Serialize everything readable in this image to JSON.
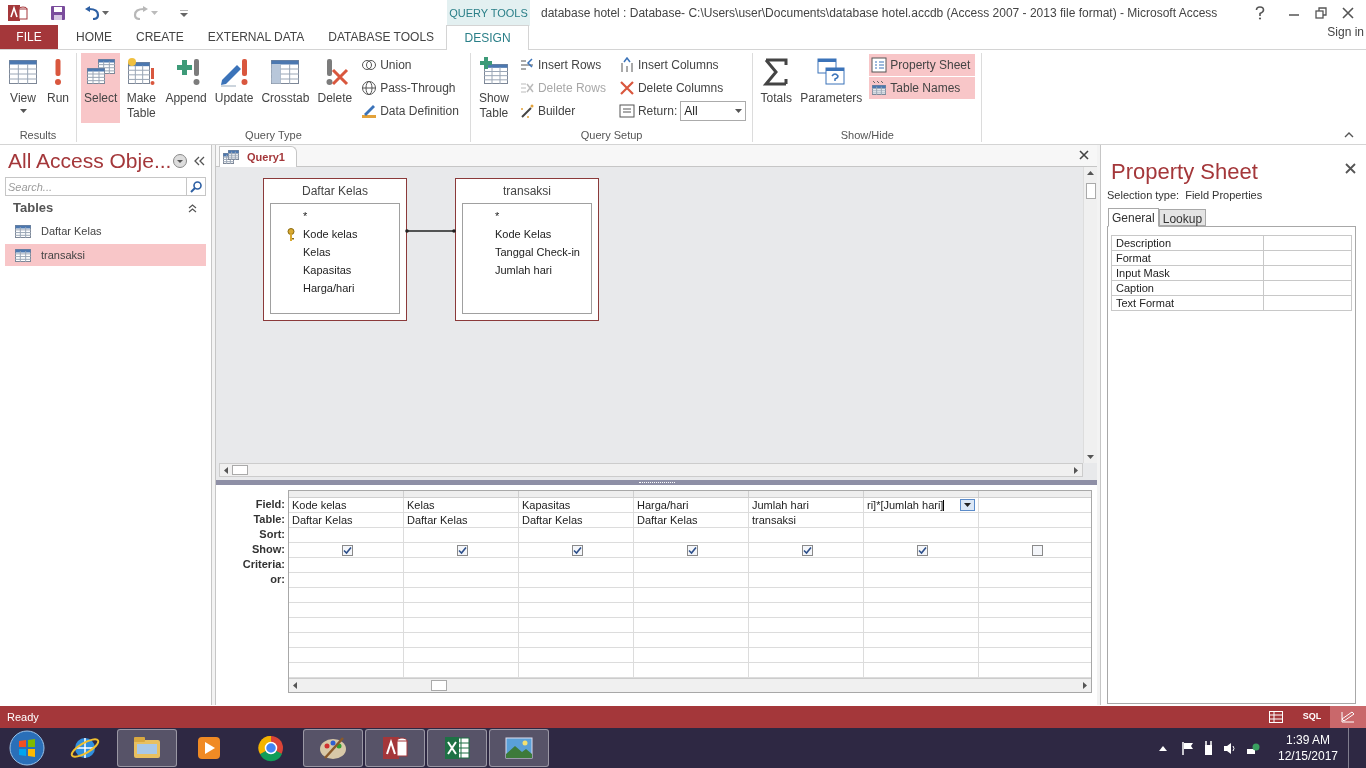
{
  "window": {
    "title": "database hotel : Database- C:\\Users\\user\\Documents\\database hotel.accdb (Access 2007 - 2013 file format) - Microsoft Access",
    "context_tab": "QUERY TOOLS"
  },
  "tabs": [
    {
      "label": "FILE",
      "kind": "file",
      "selected": false
    },
    {
      "label": "HOME",
      "kind": "tab",
      "selected": false
    },
    {
      "label": "CREATE",
      "kind": "tab",
      "selected": false
    },
    {
      "label": "EXTERNAL DATA",
      "kind": "tab",
      "selected": false
    },
    {
      "label": "DATABASE TOOLS",
      "kind": "tab",
      "selected": false
    },
    {
      "label": "DESIGN",
      "kind": "context",
      "selected": true
    }
  ],
  "sign_in": "Sign in",
  "ribbon": [
    {
      "label": "Results",
      "buttons": [
        {
          "kind": "large",
          "label": "View",
          "dropdown": true
        },
        {
          "kind": "large",
          "label": "Run",
          "dropdown": false
        }
      ]
    },
    {
      "label": "Query Type",
      "buttons": [
        {
          "kind": "large",
          "label": "Select",
          "selected": true
        },
        {
          "kind": "large",
          "label": "Make Table",
          "selected": false
        },
        {
          "kind": "large",
          "label": "Append",
          "selected": false
        },
        {
          "kind": "large",
          "label": "Update",
          "selected": false
        },
        {
          "kind": "large",
          "label": "Crosstab",
          "selected": false
        },
        {
          "kind": "large",
          "label": "Delete",
          "selected": false
        },
        {
          "kind": "small",
          "label": "Union",
          "selected": false
        },
        {
          "kind": "small",
          "label": "Pass-Through",
          "selected": false
        },
        {
          "kind": "small",
          "label": "Data Definition",
          "selected": false
        }
      ]
    },
    {
      "label": "Query Setup",
      "buttons": [
        {
          "kind": "large",
          "label": "Show Table",
          "disabled": false
        },
        {
          "kind": "small",
          "label": "Insert Rows",
          "disabled": false
        },
        {
          "kind": "small",
          "label": "Delete Rows",
          "disabled": true
        },
        {
          "kind": "small",
          "label": "Builder",
          "disabled": false
        },
        {
          "kind": "small",
          "label": "Insert Columns",
          "disabled": false
        },
        {
          "kind": "small",
          "label": "Delete Columns",
          "disabled": false
        },
        {
          "kind": "combo",
          "label": "Return:",
          "value": "All",
          "disabled": false
        }
      ]
    },
    {
      "label": "Show/Hide",
      "buttons": [
        {
          "kind": "large",
          "label": "Totals",
          "on": false
        },
        {
          "kind": "large",
          "label": "Parameters",
          "on": false
        },
        {
          "kind": "small",
          "label": "Property Sheet",
          "on": true
        },
        {
          "kind": "small",
          "label": "Table Names",
          "on": true
        }
      ]
    }
  ],
  "nav_pane": {
    "title": "All Access Obje...",
    "search_placeholder": "Search...",
    "group": "Tables",
    "items": [
      {
        "label": "Daftar Kelas",
        "selected": false
      },
      {
        "label": "transaksi",
        "selected": true
      }
    ]
  },
  "document_tab": {
    "label": "Query1"
  },
  "design_tables": [
    {
      "name": "Daftar Kelas",
      "fields": [
        {
          "name": "*",
          "key": false
        },
        {
          "name": "Kode kelas",
          "key": true
        },
        {
          "name": "Kelas",
          "key": false
        },
        {
          "name": "Kapasitas",
          "key": false
        },
        {
          "name": "Harga/hari",
          "key": false
        }
      ]
    },
    {
      "name": "transaksi",
      "fields": [
        {
          "name": "*",
          "key": false
        },
        {
          "name": "Kode Kelas",
          "key": false
        },
        {
          "name": "Tanggal Check-in",
          "key": false
        },
        {
          "name": "Jumlah hari",
          "key": false
        }
      ]
    }
  ],
  "query_grid": {
    "row_labels": [
      "Field:",
      "Table:",
      "Sort:",
      "Show:",
      "Criteria:",
      "or:"
    ],
    "columns": [
      {
        "field": "Kode kelas",
        "table": "Daftar Kelas",
        "show": true,
        "active": false
      },
      {
        "field": "Kelas",
        "table": "Daftar Kelas",
        "show": true,
        "active": false
      },
      {
        "field": "Kapasitas",
        "table": "Daftar Kelas",
        "show": true,
        "active": false
      },
      {
        "field": "Harga/hari",
        "table": "Daftar Kelas",
        "show": true,
        "active": false
      },
      {
        "field": "Jumlah hari",
        "table": "transaksi",
        "show": true,
        "active": false
      },
      {
        "field": "ri]*[Jumlah hari]",
        "show": true,
        "active": true
      },
      {
        "show": false,
        "active": false
      }
    ]
  },
  "property_sheet": {
    "title": "Property Sheet",
    "selection_label": "Selection type:",
    "selection_value": "Field Properties",
    "tabs": [
      {
        "label": "General",
        "selected": true
      },
      {
        "label": "Lookup",
        "selected": false
      }
    ],
    "properties": [
      "Description",
      "Format",
      "Input Mask",
      "Caption",
      "Text Format"
    ]
  },
  "status_bar": {
    "text": "Ready",
    "views": [
      {
        "kind": "datasheet",
        "selected": false
      },
      {
        "kind": "sql",
        "label": "SQL",
        "selected": false
      },
      {
        "kind": "design",
        "selected": true
      }
    ]
  },
  "taskbar": {
    "apps": [
      {
        "kind": "globe",
        "running": false
      },
      {
        "kind": "folder",
        "running": true
      },
      {
        "kind": "play",
        "running": false
      },
      {
        "kind": "ball",
        "running": false
      },
      {
        "kind": "palette",
        "running": true
      },
      {
        "kind": "db",
        "running": true
      },
      {
        "kind": "sheet",
        "running": true
      },
      {
        "kind": "photo",
        "running": true
      }
    ],
    "time": "1:39 AM",
    "date": "12/15/2017"
  }
}
